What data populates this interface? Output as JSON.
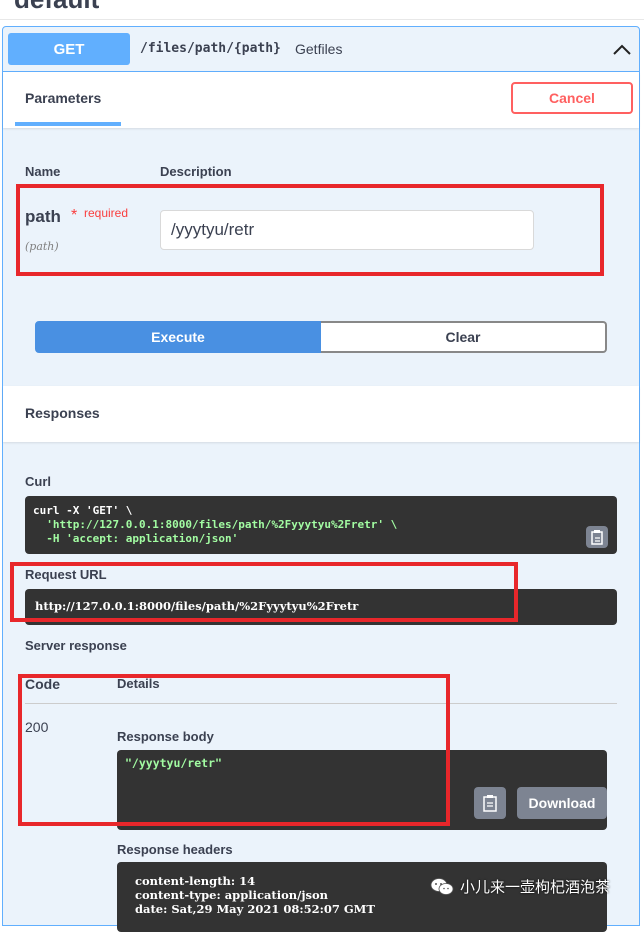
{
  "page_heading": "default",
  "operation": {
    "method": "GET",
    "path": "/files/path/{path}",
    "summary": "Getfiles"
  },
  "parameters_tab": {
    "title": "Parameters",
    "cancel_label": "Cancel",
    "col_name": "Name",
    "col_description": "Description",
    "param": {
      "name": "path",
      "required_star": "*",
      "required_label": "required",
      "location": "(path)",
      "value": "/yyytyu/retr"
    }
  },
  "actions": {
    "execute_label": "Execute",
    "clear_label": "Clear"
  },
  "responses": {
    "title": "Responses",
    "curl_label": "Curl",
    "curl_lines": [
      "curl -X 'GET' \\",
      "  'http://127.0.0.1:8000/files/path/%2Fyyytyu%2Fretr' \\",
      "  -H 'accept: application/json'"
    ],
    "request_url_label": "Request URL",
    "request_url": "http://127.0.0.1:8000/files/path/%2Fyyytyu%2Fretr",
    "server_response_label": "Server response",
    "code_header": "Code",
    "details_header": "Details",
    "status_code": "200",
    "response_body_label": "Response body",
    "response_body": "\"/yyytyu/retr\"",
    "download_label": "Download",
    "response_headers_label": "Response headers",
    "response_headers": [
      "content-length: 14",
      "content-type: application/json",
      "date: Sat,29 May 2021 08:52:07 GMT"
    ]
  },
  "watermark": {
    "text": "小儿来一壶枸杞酒泡茶",
    "icon": "wechat-icon"
  },
  "colors": {
    "get_blue": "#61affe",
    "execute_blue": "#4990e2",
    "cancel_red": "#ff6060",
    "annotation_red": "#e8272b",
    "code_bg": "#333333",
    "code_green": "#a2fca2"
  }
}
